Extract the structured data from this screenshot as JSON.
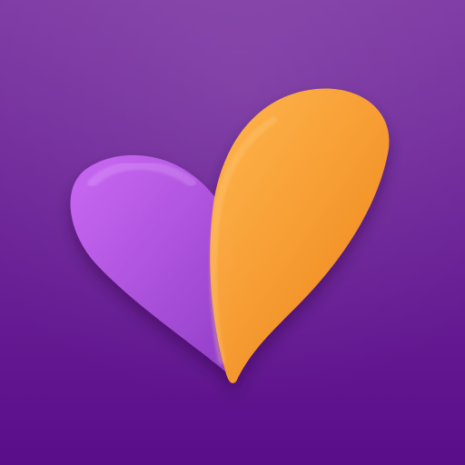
{
  "app_icon": {
    "icon": "heart-check-icon",
    "colors": {
      "background_top": "#7e3aa4",
      "background_bottom": "#5a0d8a",
      "left_petal_light": "#c766f2",
      "left_petal_dark": "#9a44cf",
      "right_petal_light": "#ffb247",
      "right_petal_dark": "#f28a1b"
    }
  }
}
